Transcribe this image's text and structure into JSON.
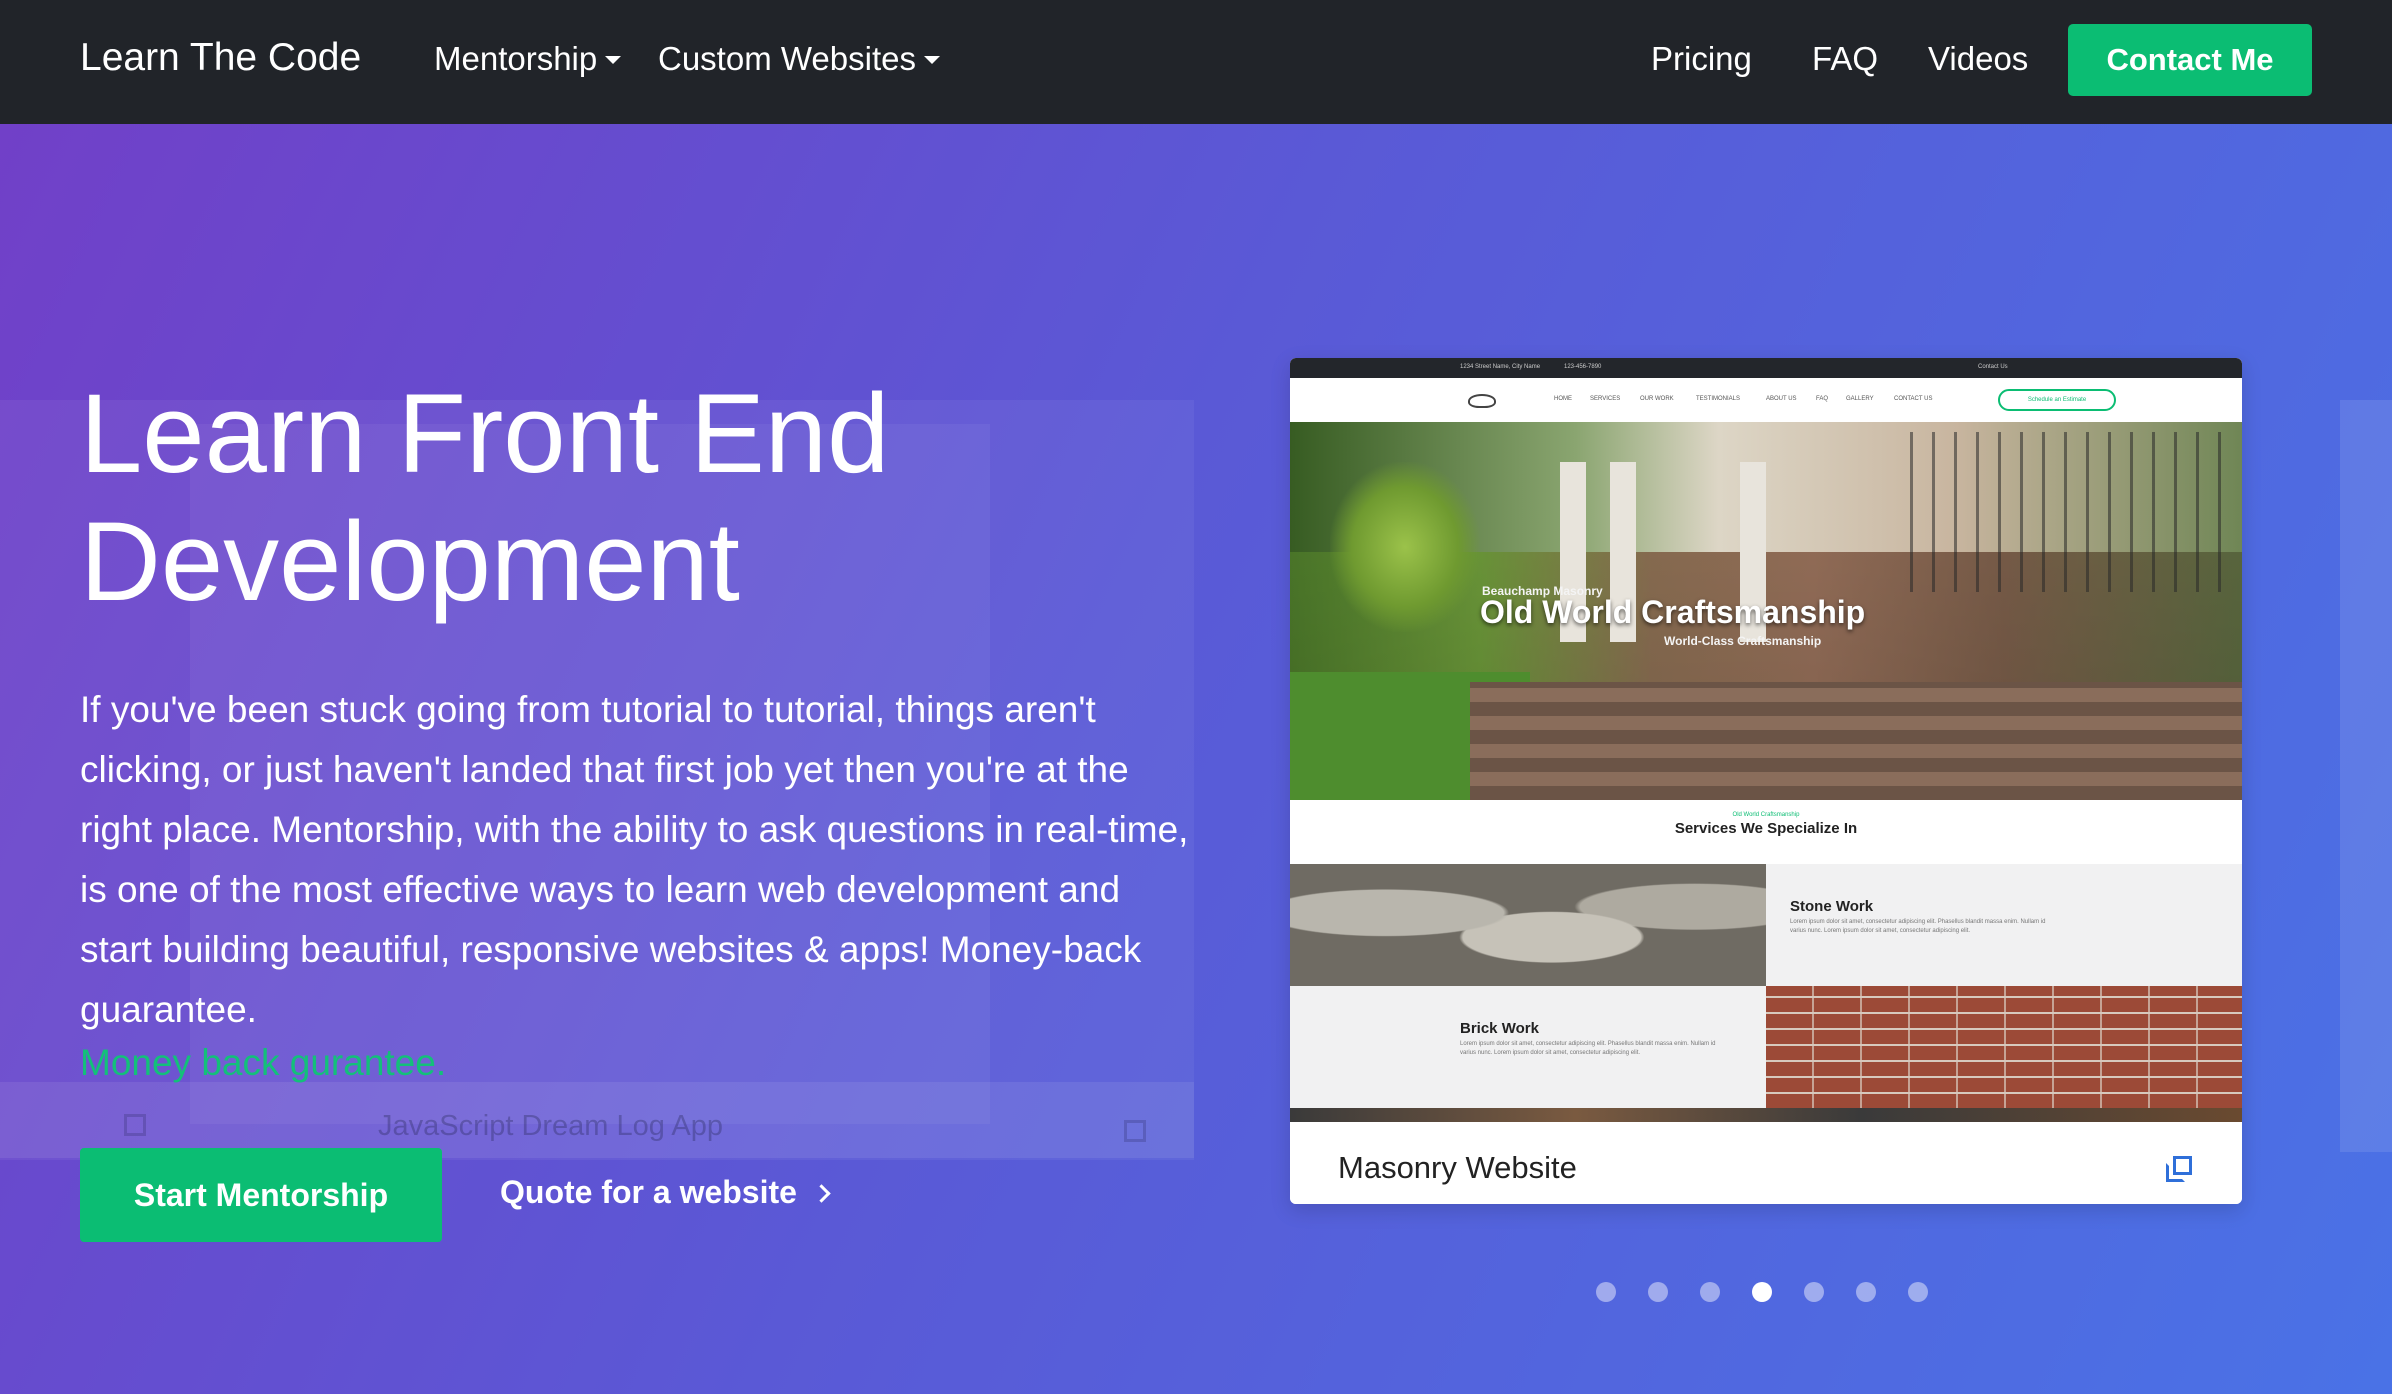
{
  "nav": {
    "brand": "Learn The Code",
    "menus": [
      {
        "label": "Mentorship",
        "icon": "caret-down-icon"
      },
      {
        "label": "Custom Websites",
        "icon": "caret-down-icon"
      }
    ],
    "links": [
      "Pricing",
      "FAQ",
      "Videos"
    ],
    "cta": "Contact Me"
  },
  "hero": {
    "title_line1": "Learn Front End",
    "title_line2": "Development",
    "body": "If you've been stuck going from tutorial to tutorial, things aren't clicking, or just haven't landed that first job yet then you're at the right place. Mentorship, with the ability to ask questions in real-time, is one of the most effective ways to learn web development and start building beautiful, responsive websites & apps! Money-back guarantee.",
    "highlight_link": "Money back gurantee.",
    "primary_button": "Start Mentorship",
    "secondary_link": "Quote for a website",
    "secondary_icon": "chevron-right-icon",
    "ghost_slide_title": "JavaScript Dream Log App"
  },
  "carousel": {
    "card_title": "Masonry Website",
    "card_icon": "external-link-icon",
    "dot_count": 7,
    "active_index": 3,
    "preview": {
      "topbar_left": "1234 Street Name, City Name",
      "topbar_phone": "123-456-7890",
      "topbar_right": "Contact Us",
      "nav_items": [
        "HOME",
        "SERVICES",
        "OUR WORK",
        "TESTIMONIALS",
        "ABOUT US",
        "FAQ",
        "GALLERY",
        "CONTACT US"
      ],
      "nav_button": "Schedule an Estimate",
      "hero_sub": "Beauchamp Masonry",
      "hero_title": "Old World Craftsmanship",
      "hero_tag": "World-Class Craftsmanship",
      "section_kicker": "Old World Craftsmanship",
      "section_title": "Services We Specialize In",
      "service_1_title": "Stone Work",
      "service_1_text": "Lorem ipsum dolor sit amet, consectetur adipiscing elit. Phasellus blandit massa enim. Nullam id varius nunc. Lorem ipsum dolor sit amet, consectetur adipiscing elit.",
      "service_2_title": "Brick Work",
      "service_2_text": "Lorem ipsum dolor sit amet, consectetur adipiscing elit. Phasellus blandit massa enim. Nullam id varius nunc. Lorem ipsum dolor sit amet, consectetur adipiscing elit."
    }
  },
  "colors": {
    "navbar": "#212429",
    "accent_green": "#0bbd73",
    "gradient_start": "#7140c8",
    "gradient_end": "#4a72e6",
    "link_blue": "#2f6fd9"
  }
}
